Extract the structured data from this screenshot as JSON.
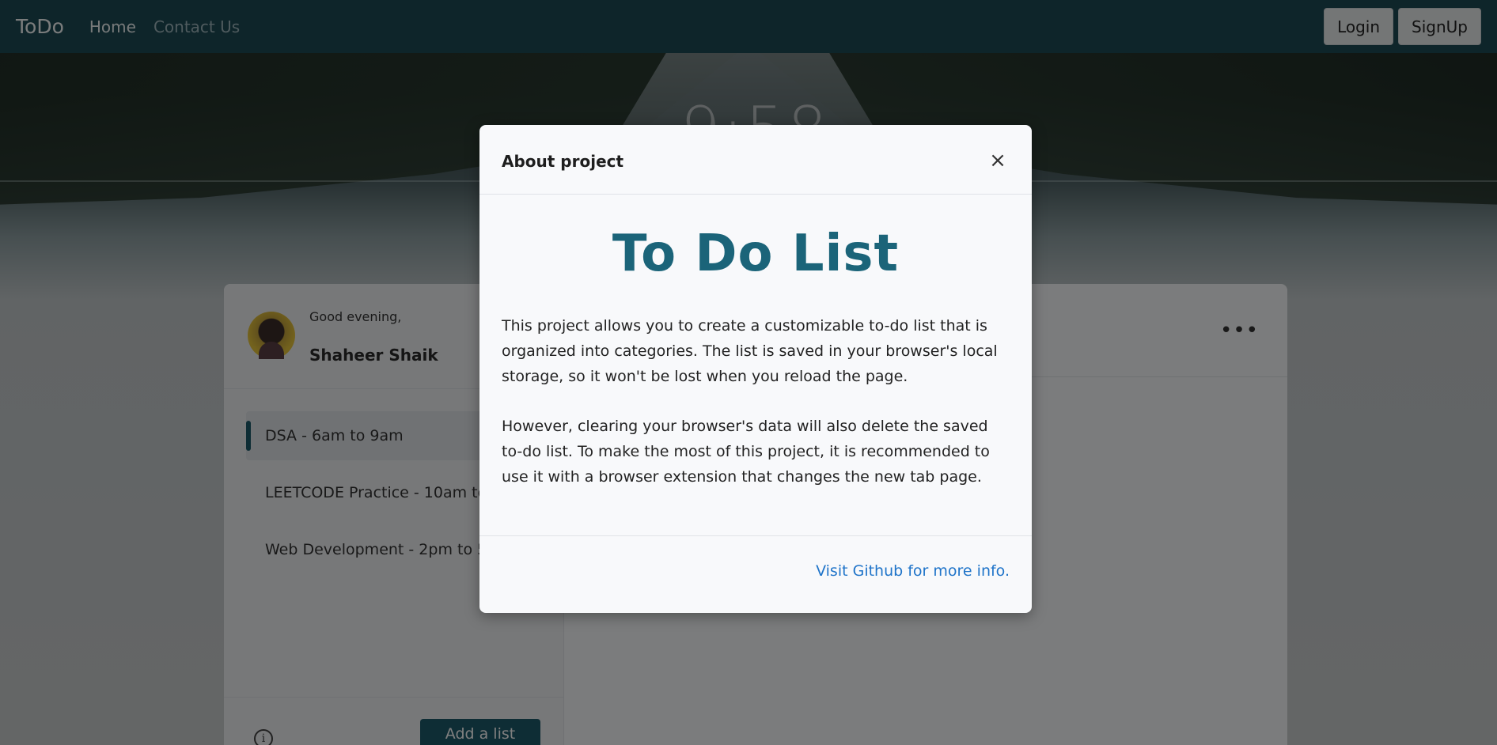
{
  "navbar": {
    "brand": "ToDo",
    "links": [
      "Home",
      "Contact Us"
    ],
    "login_label": "Login",
    "signup_label": "SignUp",
    "bg_color": "#1d4a55"
  },
  "clock": {
    "time": "9:58"
  },
  "profile": {
    "greeting": "Good evening,",
    "name": "Shaheer Shaik"
  },
  "lists": [
    {
      "label": "DSA - 6am to 9am",
      "active": true
    },
    {
      "label": "LEETCODE Practice - 10am to",
      "active": false
    },
    {
      "label": "Web Development - 2pm to 5",
      "active": false
    }
  ],
  "sidebar_footer": {
    "info_icon": "info-icon",
    "add_label": "Add a list"
  },
  "main": {
    "menu_icon": "more-dots-icon"
  },
  "modal": {
    "title": "About project",
    "close_glyph": "×",
    "heading": "To Do List",
    "paragraph_1": "This project allows you to create a customizable to-do list that is organized into categories. The list is saved in your browser's local storage, so it won't be lost when you reload the page.",
    "paragraph_2": "However, clearing your browser's data will also delete the saved to-do list. To make the most of this project, it is recommended to use it with a browser extension that changes the new tab page.",
    "footer_link": "Visit Github for more info.",
    "accent_color": "#1b6479",
    "link_color": "#1f74c9"
  }
}
